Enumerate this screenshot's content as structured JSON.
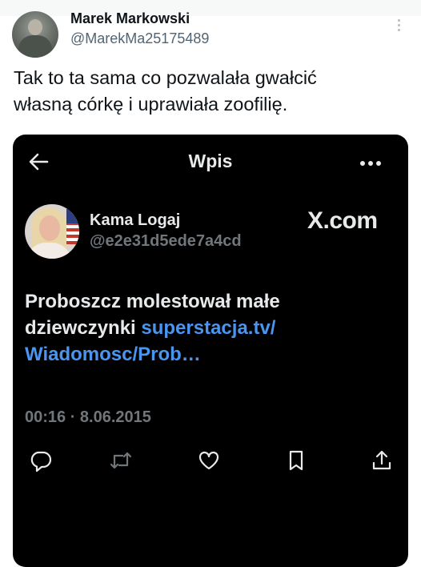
{
  "tweet": {
    "author_name": "Marek Markowski",
    "author_handle": "@MarekMa25175489",
    "text_line1": "Tak to ta sama co pozwalała gwałcić",
    "text_line2": "własną córkę i uprawiała zoofilię."
  },
  "embed": {
    "header_title": "Wpis",
    "quoted": {
      "name": "Kama Logaj",
      "handle": "@e2e31d5ede7a4cd",
      "watermark": "X.com",
      "text_line1": "Proboszcz molestował małe",
      "text_line2_plain": "dziewczynki ",
      "link_part1": "superstacja.tv/",
      "link_part2": "Wiadomosc/Prob…",
      "timestamp": "00:16 · 8.06.2015"
    }
  },
  "icons": {
    "back": "arrow-left-icon",
    "more": "more-horizontal-icon",
    "reply": "reply-icon",
    "retweet": "retweet-icon",
    "like": "heart-icon",
    "bookmark": "bookmark-icon",
    "share": "share-icon"
  },
  "colors": {
    "link": "#4a95f0",
    "muted": "#71767b",
    "card_bg": "#000000"
  }
}
